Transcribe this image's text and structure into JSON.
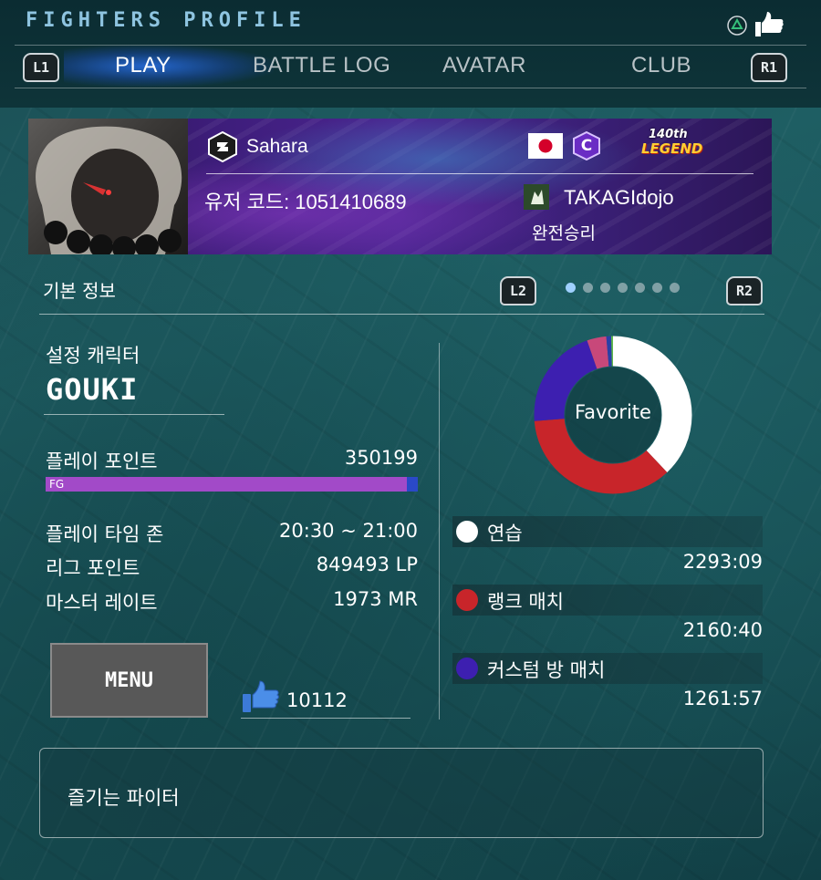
{
  "header": {
    "title": "FIGHTERS PROFILE",
    "tabs": [
      {
        "label": "PLAY",
        "active": true
      },
      {
        "label": "BATTLE LOG",
        "active": false
      },
      {
        "label": "AVATAR",
        "active": false
      },
      {
        "label": "CLUB",
        "active": false
      }
    ],
    "left_shoulder": "L1",
    "right_shoulder": "R1"
  },
  "banner": {
    "platform": "Sahara",
    "user_code": "유저 코드: 1051410689",
    "rank_badge": "C",
    "title_badge_top": "140th",
    "title_badge_bottom": "LEGEND",
    "club_name": "TAKAGIdojo",
    "title_text": "완전승리",
    "country": "JP"
  },
  "section": {
    "label": "기본 정보",
    "left_button": "L2",
    "right_button": "R2",
    "page_index": 1,
    "page_count": 7
  },
  "stats": {
    "char_label": "설정 캐릭터",
    "char_name": "GOUKI",
    "play_points_label": "플레이 포인트",
    "play_points_value": "350199",
    "play_points_rank": "FG",
    "play_points_progress": 0.97,
    "time_zone_label": "플레이 타임 존",
    "time_zone_value": "20:30 ~ 21:00",
    "league_points_label": "리그 포인트",
    "league_points_value": "849493 LP",
    "master_rate_label": "마스터 레이트",
    "master_rate_value": "1973 MR"
  },
  "menu_button": "MENU",
  "likes_count": "10112",
  "chart_data": {
    "type": "pie",
    "center_label": "Favorite",
    "series": [
      {
        "name": "연습",
        "value": 2293.15,
        "time": "2293:09",
        "color": "#ffffff"
      },
      {
        "name": "랭크 매치",
        "value": 2160.67,
        "time": "2160:40",
        "color": "#c8252a"
      },
      {
        "name": "커스텀 방 매치",
        "value": 1261.95,
        "time": "1261:57",
        "color": "#3d1fb0"
      },
      {
        "name": "",
        "value": 240,
        "time": "",
        "color": "#c8487a"
      },
      {
        "name": "",
        "value": 60,
        "time": "",
        "color": "#2a3fa8"
      },
      {
        "name": "",
        "value": 25,
        "time": "",
        "color": "#5fb84a"
      }
    ]
  },
  "favorite_fighters_label": "즐기는 파이터"
}
